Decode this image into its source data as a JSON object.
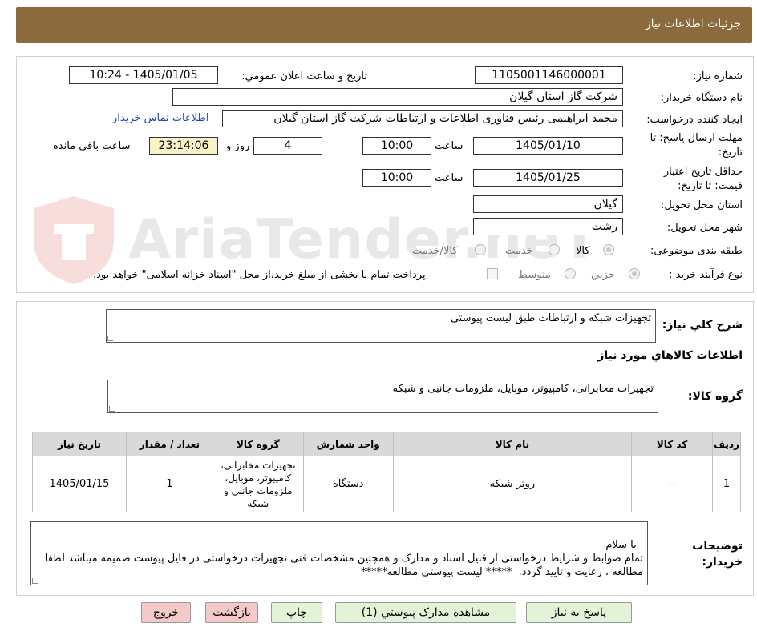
{
  "header": {
    "title": "جزئیات اطلاعات نیاز"
  },
  "form": {
    "need_number_label": "شماره نیاز:",
    "need_number": "1105001146000001",
    "announce_label": "تاریخ و ساعت اعلان عمومي:",
    "announce_value": "1405/01/05 - 10:24",
    "buyer_org_label": "نام دستگاه خريدار:",
    "buyer_org": "شرکت گاز استان گیلان",
    "requester_label": "ايجاد کننده درخواست:",
    "requester": "محمد ابراهیمی رئیس فناوری اطلاعات و ارتباطات شرکت گاز استان گیلان",
    "buyer_contact_link": "اطلاعات تماس خریدار",
    "deadline_label": "مهلت ارسال پاسخ: تا تاریخ:",
    "deadline_date": "1405/01/10",
    "time_label": "ساعت",
    "deadline_time": "10:00",
    "days_value": "4",
    "days_label": "روز و",
    "remaining_time": "23:14:06",
    "remaining_label": "ساعت باقي مانده",
    "validity_label": "حداقل تاريخ اعتبار قيمت: تا تاريخ:",
    "validity_date": "1405/01/25",
    "validity_time": "10:00",
    "province_label": "استان محل تحويل:",
    "province": "گیلان",
    "city_label": "شهر محل تحويل:",
    "city": "رشت",
    "category_label": "طبقه بندی موضوعی:",
    "category_options": [
      "کالا",
      "خدمت",
      "کالا/خدمت"
    ],
    "category_selected": "کالا",
    "process_label": "نوع فرآيند خريد :",
    "process_options": [
      "جزيي",
      "متوسط"
    ],
    "process_selected": "جزيي",
    "treasury_note": "پرداخت تمام يا بخشی از مبلغ خريد،از محل \"اسناد خزانه اسلامی\" خواهد بود."
  },
  "summary": {
    "general_desc_label": "شرح کلي نياز:",
    "general_desc": "تجهیزات شبکه و ارتباطات  طبق لیست پیوستی",
    "goods_info_title": "اطلاعات کالاهاي مورد نياز",
    "goods_group_label": "گروه کالا:",
    "goods_group": "تجهیزات مخابراتی، کامپیوتر، موبایل، ملزومات جانبی و شبکه"
  },
  "table": {
    "headers": [
      "رديف",
      "کد کالا",
      "نام کالا",
      "واحد شمارش",
      "گروه کالا",
      "تعداد / مقدار",
      "تاريخ نياز"
    ],
    "rows": [
      [
        "1",
        "--",
        "روتر شبکه",
        "دستگاه",
        "تجهیزات مخابراتی، کامپیوتر، موبایل، ملزومات جانبی و شبکه",
        "1",
        "1405/01/15"
      ]
    ]
  },
  "buyer_notes": {
    "label": "توضيحات خريدار:",
    "text": "با سلام\nتمام ضوابط و شرايط درخواستی از قبيل اسناد و مدارک و همچنين مشخصات فنی تجهيزات درخواستی در فايل پيوست ضميمه ميباشد لطفا مطالعه ، رعايت و تاييد گردد.  ***** ليست پيوستی مطالعه*****"
  },
  "buttons": {
    "reply": "پاسخ به نياز",
    "attachments": "مشاهده مدارک پيوستي (1)",
    "print": "چاپ",
    "back": "بازگشت",
    "exit": "خروج"
  },
  "watermark": {
    "text": "AriaTender.neT"
  },
  "colors": {
    "header_bg": "#8b6b3e",
    "remaining_bg": "#f7f2c8",
    "green_btn": "#e2f3d7",
    "pink_btn": "#f6c9c9",
    "table_head": "#d9d9d9"
  }
}
